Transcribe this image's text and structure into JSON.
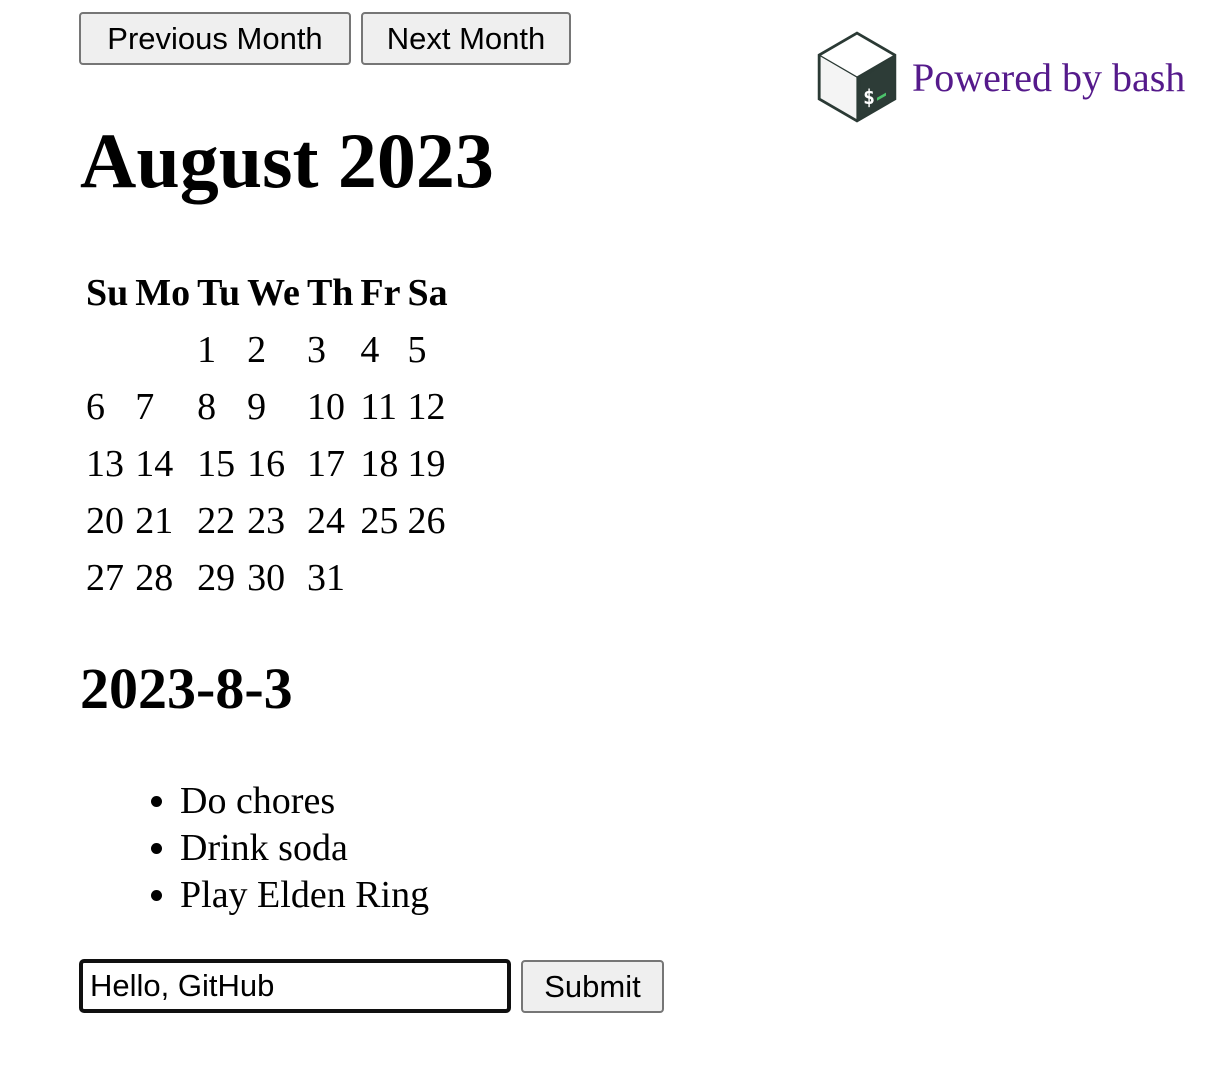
{
  "nav": {
    "prev_label": "Previous Month",
    "next_label": "Next Month"
  },
  "powered": {
    "text": "Powered by bash",
    "logo_icon": "bash-logo-icon",
    "logo_glyph": "$",
    "link_color": "#551a8b"
  },
  "calendar": {
    "month_title": "August 2023",
    "weekdays": [
      "Su",
      "Mo",
      "Tu",
      "We",
      "Th",
      "Fr",
      "Sa"
    ],
    "weeks": [
      [
        "",
        "",
        "1",
        "2",
        "3",
        "4",
        "5"
      ],
      [
        "6",
        "7",
        "8",
        "9",
        "10",
        "11",
        "12"
      ],
      [
        "13",
        "14",
        "15",
        "16",
        "17",
        "18",
        "19"
      ],
      [
        "20",
        "21",
        "22",
        "23",
        "24",
        "25",
        "26"
      ],
      [
        "27",
        "28",
        "29",
        "30",
        "31",
        "",
        ""
      ]
    ]
  },
  "selected": {
    "date": "2023-8-3",
    "todos": [
      "Do chores",
      "Drink soda",
      "Play Elden Ring"
    ]
  },
  "form": {
    "input_value": "Hello, GitHub",
    "submit_label": "Submit"
  }
}
